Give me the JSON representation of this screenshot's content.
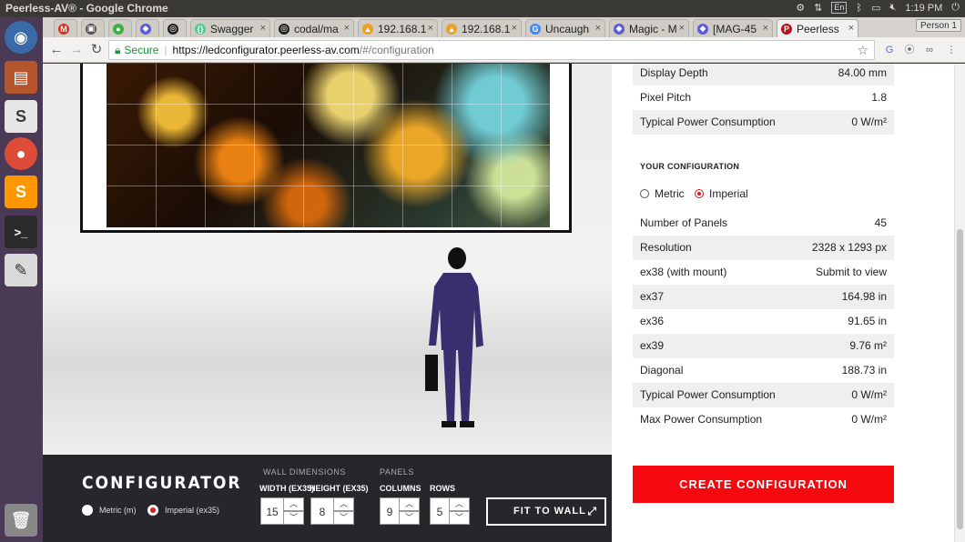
{
  "window": {
    "title": "Peerless-AV® - Google Chrome",
    "tray": {
      "lang": "En",
      "time": "1:19 PM"
    }
  },
  "tabs": [
    {
      "label": "",
      "icon": "gmail-icon",
      "color": "#d93025"
    },
    {
      "label": "",
      "icon": "robot-icon",
      "color": "#555555"
    },
    {
      "label": "",
      "icon": "green-circle-icon",
      "color": "#3cb043"
    },
    {
      "label": "",
      "icon": "diamond-icon",
      "color": "#5b5bd6"
    },
    {
      "label": "",
      "icon": "github-icon",
      "color": "#222222"
    },
    {
      "label": "Swagger",
      "icon": "swagger-icon",
      "color": "#49cc90"
    },
    {
      "label": "codal/ma",
      "icon": "github-icon",
      "color": "#222222"
    },
    {
      "label": "192.168.1",
      "icon": "pma-icon",
      "color": "#f0a020"
    },
    {
      "label": "192.168.1",
      "icon": "pma-icon",
      "color": "#f0a020"
    },
    {
      "label": "Uncaugh",
      "icon": "google-icon",
      "color": "#4285f4"
    },
    {
      "label": "Magic - M",
      "icon": "diamond-icon",
      "color": "#5b5bd6"
    },
    {
      "label": "[MAG-45",
      "icon": "diamond-icon",
      "color": "#5b5bd6"
    },
    {
      "label": "Peerless",
      "icon": "peerless-icon",
      "color": "#b5121b"
    }
  ],
  "person_label": "Person 1",
  "address": {
    "secure_label": "Secure",
    "host": "https://ledconfigurator.peerless-av.com",
    "path": "/#/configuration"
  },
  "specs_top": [
    {
      "label": "Display Depth",
      "value": "84.00 mm"
    },
    {
      "label": "Pixel Pitch",
      "value": "1.8"
    },
    {
      "label": "Typical Power Consumption",
      "value": "0 W/m²"
    }
  ],
  "your_config": {
    "title": "YOUR CONFIGURATION",
    "metric_label": "Metric",
    "imperial_label": "Imperial",
    "selected": "Imperial",
    "rows": [
      {
        "label": "Number of Panels",
        "value": "45"
      },
      {
        "label": "Resolution",
        "value": "2328 x 1293 px"
      },
      {
        "label": "ex38 (with mount)",
        "value": "Submit to view"
      },
      {
        "label": "ex37",
        "value": "164.98 in"
      },
      {
        "label": "ex36",
        "value": "91.65 in"
      },
      {
        "label": "ex39",
        "value": "9.76 m²"
      },
      {
        "label": "Diagonal",
        "value": "188.73 in"
      },
      {
        "label": "Typical Power Consumption",
        "value": "0 W/m²"
      },
      {
        "label": "Max Power Consumption",
        "value": "0 W/m²"
      }
    ]
  },
  "create_label": "CREATE CONFIGURATION",
  "configurator": {
    "title": "CONFIGURATOR",
    "metric_label": "Metric (m)",
    "imperial_label": "Imperial (ex35)",
    "selected": "Imperial (ex35)",
    "wall_dimensions_label": "WALL DIMENSIONS",
    "width_label": "WIDTH (EX35)",
    "height_label": "HEIGHT (EX35)",
    "width_value": "15",
    "height_value": "8",
    "panels_label": "PANELS",
    "columns_label": "COLUMNS",
    "rows_label": "ROWS",
    "columns_value": "9",
    "rows_value": "5",
    "fit_label": "FIT TO WALL"
  }
}
